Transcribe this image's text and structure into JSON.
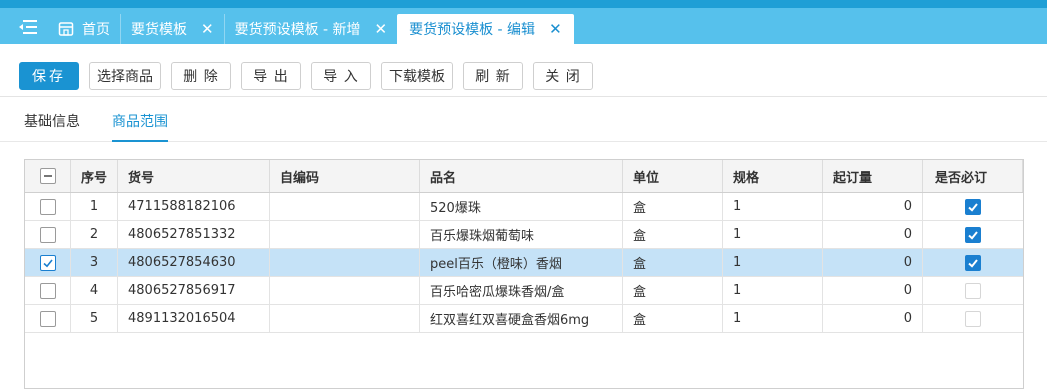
{
  "tabs": [
    {
      "label": "首页",
      "icon": "home-icon",
      "closable": false,
      "active": false
    },
    {
      "label": "要货模板",
      "closable": true,
      "active": false
    },
    {
      "label": "要货预设模板 - 新增",
      "closable": true,
      "active": false
    },
    {
      "label": "要货预设模板 - 编辑",
      "closable": true,
      "active": true
    }
  ],
  "toolbar": {
    "save": "保存",
    "select_goods": "选择商品",
    "delete": "删 除",
    "export": "导 出",
    "import": "导 入",
    "download_template": "下载模板",
    "refresh": "刷 新",
    "close": "关 闭"
  },
  "subtabs": {
    "basic_info": "基础信息",
    "goods_scope": "商品范围",
    "active": "goods_scope"
  },
  "table": {
    "headers": [
      "序号",
      "货号",
      "自编码",
      "品名",
      "单位",
      "规格",
      "起订量",
      "是否必订"
    ],
    "rows": [
      {
        "selected": false,
        "seq": "1",
        "code": "4711588182106",
        "self_code": "",
        "name": "520爆珠",
        "unit": "盒",
        "spec": "1",
        "min_qty": "0",
        "required": true
      },
      {
        "selected": false,
        "seq": "2",
        "code": "4806527851332",
        "self_code": "",
        "name": "百乐爆珠烟葡萄味",
        "unit": "盒",
        "spec": "1",
        "min_qty": "0",
        "required": true
      },
      {
        "selected": true,
        "seq": "3",
        "code": "4806527854630",
        "self_code": "",
        "name": "peel百乐（橙味）香烟",
        "unit": "盒",
        "spec": "1",
        "min_qty": "0",
        "required": true
      },
      {
        "selected": false,
        "seq": "4",
        "code": "4806527856917",
        "self_code": "",
        "name": "百乐哈密瓜爆珠香烟/盒",
        "unit": "盒",
        "spec": "1",
        "min_qty": "0",
        "required": false
      },
      {
        "selected": false,
        "seq": "5",
        "code": "4891132016504",
        "self_code": "",
        "name": "红双喜红双喜硬盒香烟6mg",
        "unit": "盒",
        "spec": "1",
        "min_qty": "0",
        "required": false
      }
    ]
  },
  "colors": {
    "tabbar": "#56c1ec",
    "tabbar_stripe": "#1e9fd6",
    "primary": "#1a93d2",
    "selected_row": "#c5e2f7",
    "checkbox_checked": "#1a7fd0"
  }
}
